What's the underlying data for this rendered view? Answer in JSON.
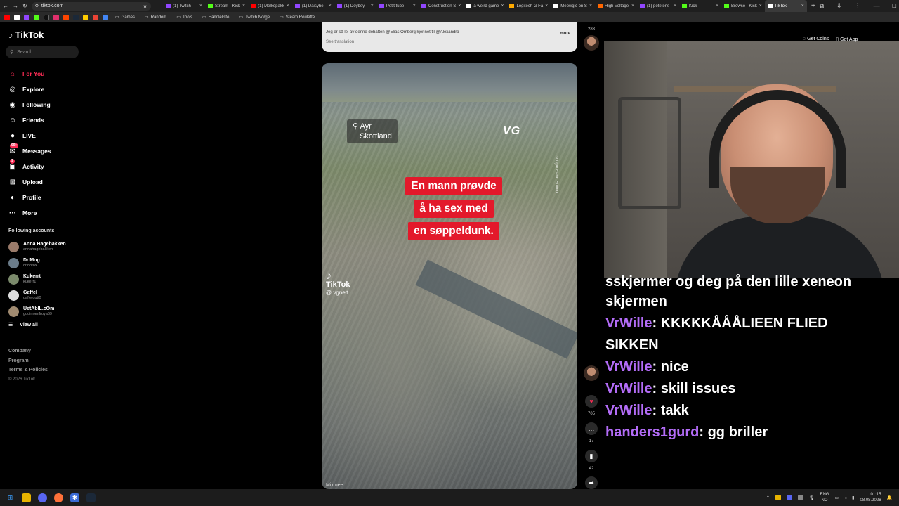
{
  "browser": {
    "url": "tiktok.com",
    "tabs": [
      {
        "label": "(1) Twitch",
        "color": "#9146ff"
      },
      {
        "label": "Stream - Kick",
        "color": "#53fc18"
      },
      {
        "label": "(1) Melkepakk",
        "color": "#ff0000"
      },
      {
        "label": "(1) Daisyhe",
        "color": "#9146ff"
      },
      {
        "label": "(1) Doybey",
        "color": "#9146ff"
      },
      {
        "label": "Petit tube",
        "color": "#9146ff"
      },
      {
        "label": "Construction S",
        "color": "#9146ff"
      },
      {
        "label": "a weird game",
        "color": "#ffffff"
      },
      {
        "label": "Logitech G Fa",
        "color": "#ffaa00"
      },
      {
        "label": "Meowgic on S",
        "color": "#ffffff"
      },
      {
        "label": "High Voltage",
        "color": "#ff6600"
      },
      {
        "label": "(1) potetens",
        "color": "#9146ff"
      },
      {
        "label": "Kick",
        "color": "#53fc18"
      },
      {
        "label": "Browse - Kick",
        "color": "#53fc18"
      },
      {
        "label": "TikTok",
        "color": "#ffffff"
      }
    ],
    "bookmarks": [
      {
        "label": "Games"
      },
      {
        "label": "Random"
      },
      {
        "label": "Tools"
      },
      {
        "label": "Handleliste"
      },
      {
        "label": "Twitch Norge"
      },
      {
        "label": "Steam Roulette"
      }
    ]
  },
  "sidebar": {
    "logo": "TikTok",
    "search_placeholder": "Search",
    "nav": [
      {
        "label": "For You",
        "icon": "home-icon",
        "glyph": "⌂",
        "active": true
      },
      {
        "label": "Explore",
        "icon": "compass-icon",
        "glyph": "◎"
      },
      {
        "label": "Following",
        "icon": "following-icon",
        "glyph": "◉"
      },
      {
        "label": "Friends",
        "icon": "friends-icon",
        "glyph": "☺"
      },
      {
        "label": "LIVE",
        "icon": "live-icon",
        "glyph": "●"
      },
      {
        "label": "Messages",
        "icon": "messages-icon",
        "glyph": "✉",
        "badge": "99+"
      },
      {
        "label": "Activity",
        "icon": "activity-icon",
        "glyph": "▣",
        "badge": "9"
      },
      {
        "label": "Upload",
        "icon": "upload-icon",
        "glyph": "⊞"
      },
      {
        "label": "Profile",
        "icon": "profile-icon",
        "glyph": "◐"
      },
      {
        "label": "More",
        "icon": "more-icon",
        "glyph": "···"
      }
    ],
    "following_title": "Following accounts",
    "accounts": [
      {
        "name": "Anna Hagebakken",
        "handle": "annahagebakken"
      },
      {
        "name": "Dr.Mog",
        "handle": "dr.botox"
      },
      {
        "name": "Kukerrt",
        "handle": "kukerr1"
      },
      {
        "name": "Gaffel",
        "handle": "gaffelgutt0"
      },
      {
        "name": "UstAbIL.cOm",
        "handle": "gudinnenfroya69"
      }
    ],
    "view_all": "View all",
    "footer": [
      "Company",
      "Program",
      "Terms & Policies"
    ],
    "copyright": "© 2026 TikTok"
  },
  "feed": {
    "prev_caption": "Jeg er så lei av denne debatten @Elias Omberg kjennet til @Alexandra",
    "prev_more": "more",
    "prev_see_translation": "See translation",
    "video": {
      "location_line1": "Ayr",
      "location_line2": "Skottland",
      "brand": "VG",
      "headline": [
        "En mann prøvde",
        "å ha sex med",
        "en søppeldunk."
      ],
      "credit": "Google Earth Studio",
      "watermark": "TikTok",
      "watermark_handle": "@ vgnett",
      "bottom_label": "Mixmee"
    }
  },
  "rail": {
    "top_count": "283",
    "likes": "705",
    "comments": "17",
    "saves": "42"
  },
  "webcam": {
    "get_coins": "Get Coins",
    "get_app": "Get App"
  },
  "chat": {
    "partial_line": "sskjermer og deg på den lille xeneon",
    "partial_line2": "skjermen",
    "messages": [
      {
        "user": "VrWille",
        "text": "KKKKKÅÅÅLIEEN FLIED"
      },
      {
        "user": "",
        "text": "SIKKEN"
      },
      {
        "user": "VrWille",
        "text": "nice"
      },
      {
        "user": "VrWille",
        "text": "skill issues"
      },
      {
        "user": "VrWille",
        "text": "takk"
      },
      {
        "user": "handers1gurd",
        "text": "gg briller"
      }
    ]
  },
  "taskbar": {
    "lang1": "ENG",
    "lang2": "NO",
    "time": "01:15",
    "date": "08.08.2026"
  },
  "colors": {
    "accent": "#fe2c55",
    "chat_user": "#b36cf7",
    "headline_bg": "#e3192b"
  }
}
